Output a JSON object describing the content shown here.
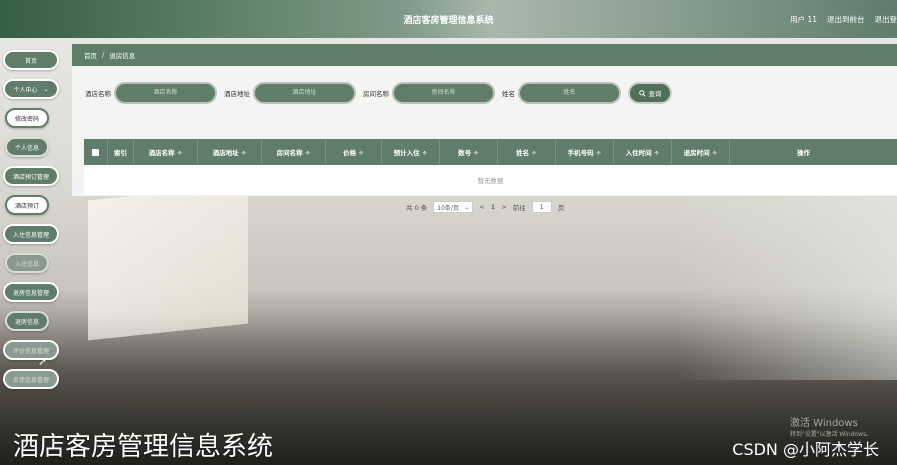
{
  "header": {
    "title": "酒店客房管理信息系统",
    "user": "用户 11",
    "back_to_front": "退出到前台",
    "logout": "退出登"
  },
  "sidebar": {
    "items": [
      {
        "label": "首页",
        "type": "main"
      },
      {
        "label": "个人中心",
        "type": "main",
        "expand": "⌄"
      },
      {
        "label": "修改密码",
        "type": "sub-light"
      },
      {
        "label": "个人信息",
        "type": "sub"
      },
      {
        "label": "酒店预订管理",
        "type": "main"
      },
      {
        "label": "酒店预订",
        "type": "sub-light"
      },
      {
        "label": "入住信息管理",
        "type": "main"
      },
      {
        "label": "入住信息",
        "type": "sub-faded"
      },
      {
        "label": "退房信息管理",
        "type": "main"
      },
      {
        "label": "退房信息",
        "type": "sub"
      },
      {
        "label": "评价信息管理",
        "type": "main-faded"
      },
      {
        "label": "反馈信息管理",
        "type": "main-faded"
      }
    ]
  },
  "breadcrumb": {
    "home": "首页",
    "separator": "/",
    "current": "退房信息"
  },
  "search": {
    "fields": [
      {
        "label": "酒店名称",
        "placeholder": "酒店名称"
      },
      {
        "label": "酒店地址",
        "placeholder": "酒店地址"
      },
      {
        "label": "房间名称",
        "placeholder": "房间名称"
      },
      {
        "label": "姓名",
        "placeholder": "姓名"
      }
    ],
    "button_label": "查询"
  },
  "table": {
    "columns": [
      "",
      "索引",
      "酒店名称 ÷",
      "酒店地址 ÷",
      "房间名称 ÷",
      "价格 ÷",
      "预计入住 ÷",
      "数号 ÷",
      "姓名 ÷",
      "手机号码 ÷",
      "入住时间 ÷",
      "退房时间 ÷",
      "操作"
    ],
    "empty_text": "暂无数据"
  },
  "pagination": {
    "total": "共 0 条",
    "page_size": "10条/页",
    "prev": "<",
    "current": "1",
    "next": ">",
    "goto": "前往",
    "goto_value": "1",
    "page_unit": "页"
  },
  "overlay": {
    "caption": "酒店客房管理信息系统",
    "csdn": "CSDN @小阿杰学长",
    "activate_title": "激活 Windows",
    "activate_sub": "转到\"设置\"以激活 Windows。"
  },
  "colors": {
    "accent": "#5f7d68",
    "header": "#355f44"
  }
}
